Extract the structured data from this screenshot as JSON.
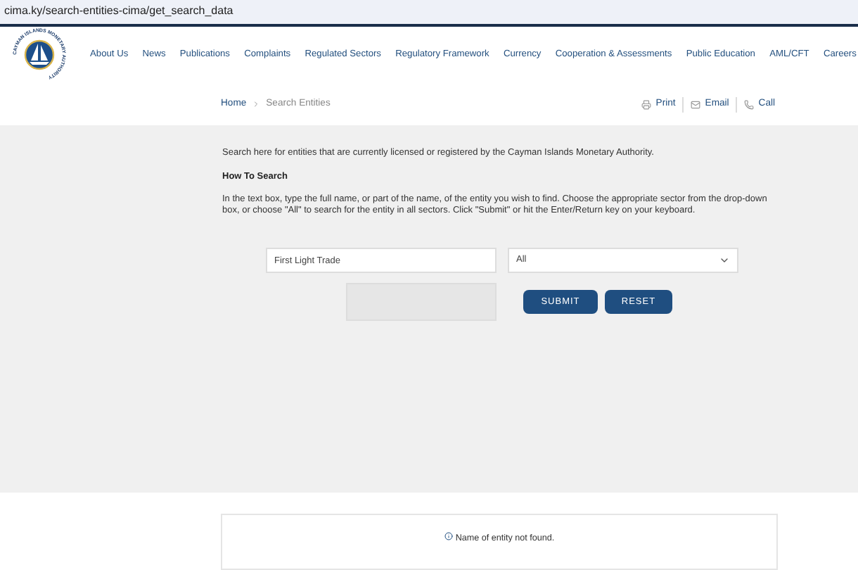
{
  "address_bar": {
    "url": "cima.ky/search-entities-cima/get_search_data"
  },
  "logo": {
    "text": "CAYMAN ISLANDS MONETARY AUTHORITY"
  },
  "nav": [
    "About Us",
    "News",
    "Publications",
    "Complaints",
    "Regulated Sectors",
    "Regulatory Framework",
    "Currency",
    "Cooperation & Assessments",
    "Public Education",
    "AML/CFT",
    "Careers"
  ],
  "breadcrumb": [
    "Home",
    "Search Entities"
  ],
  "actions": [
    {
      "kind": "print",
      "label": "Print"
    },
    {
      "kind": "email",
      "label": "Email"
    },
    {
      "kind": "call",
      "label": "Call"
    }
  ],
  "intro": "Search here for entities that are currently licensed or registered by the Cayman Islands Monetary Authority.",
  "how_to_heading": "How To Search",
  "how_to_text": "In the text box, type the full name, or part of the name, of the entity you wish to find. Choose the appropriate sector from the drop-down box, or choose \"All\" to search for the entity in all sectors. Click \"Submit\" or hit the Enter/Return key on your keyboard.",
  "search": {
    "value": "First Light Trade",
    "sector": "All"
  },
  "buttons": [
    "SUBMIT",
    "RESET"
  ],
  "result": {
    "message": "Name of entity not found."
  }
}
